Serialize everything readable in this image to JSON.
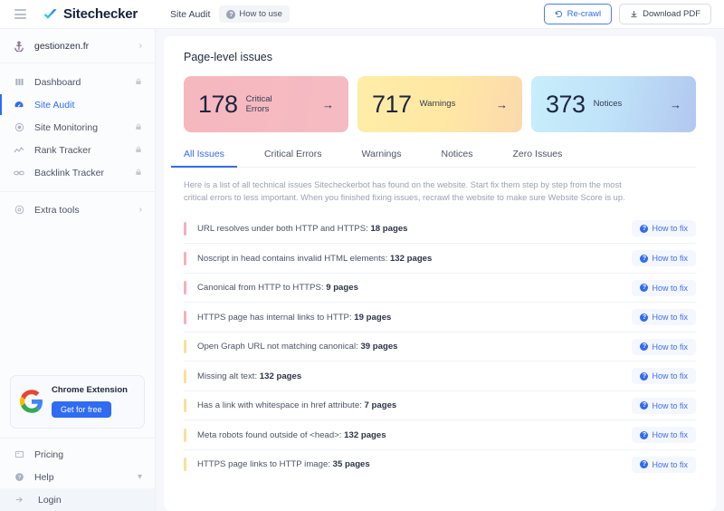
{
  "topbar": {
    "hamburger_icon": "hamburger-icon",
    "brand": "Sitechecker",
    "nav_link": "Site Audit",
    "how_to_use": "How to use",
    "recrawl": "Re-crawl",
    "download_pdf": "Download PDF"
  },
  "sidebar": {
    "site": {
      "name": "gestionzen.fr",
      "icon": "anchor-icon",
      "chevron": "›"
    },
    "items": [
      {
        "label": "Dashboard",
        "icon": "dashboard-icon",
        "locked": true,
        "active": false
      },
      {
        "label": "Site Audit",
        "icon": "site-audit-icon",
        "locked": false,
        "active": true
      },
      {
        "label": "Site Monitoring",
        "icon": "site-monitoring-icon",
        "locked": true,
        "active": false
      },
      {
        "label": "Rank Tracker",
        "icon": "rank-tracker-icon",
        "locked": true,
        "active": false
      },
      {
        "label": "Backlink Tracker",
        "icon": "backlink-tracker-icon",
        "locked": true,
        "active": false
      }
    ],
    "extra_tools": {
      "label": "Extra tools",
      "icon": "extra-tools-icon",
      "chevron": "›"
    },
    "promo": {
      "title": "Chrome Extension",
      "button": "Get for free",
      "logo": "google-logo-icon"
    },
    "footer": [
      {
        "label": "Pricing",
        "icon": "pricing-icon",
        "caret": ""
      },
      {
        "label": "Help",
        "icon": "help-icon",
        "caret": "▾"
      },
      {
        "label": "Login",
        "icon": "login-icon",
        "caret": ""
      }
    ]
  },
  "main": {
    "panel_title": "Page-level issues",
    "cards": [
      {
        "number": "178",
        "label": "Critical Errors",
        "type": "red",
        "arrow": "→"
      },
      {
        "number": "717",
        "label": "Warnings",
        "type": "yellow",
        "arrow": "→"
      },
      {
        "number": "373",
        "label": "Notices",
        "type": "blue",
        "arrow": "→"
      }
    ],
    "tabs": [
      {
        "label": "All Issues",
        "active": true
      },
      {
        "label": "Critical Errors",
        "active": false
      },
      {
        "label": "Warnings",
        "active": false
      },
      {
        "label": "Notices",
        "active": false
      },
      {
        "label": "Zero Issues",
        "active": false
      }
    ],
    "description": "Here is a list of all technical issues Sitecheckerbot has found on the website. Start fix them step by step from the most critical errors to less important. When you finished fixing issues, recrawl the website to make sure Website Score is up.",
    "how_to_fix_label": "How to fix",
    "issues": [
      {
        "title": "URL resolves under both HTTP and HTTPS:",
        "count": "18 pages",
        "severity": "critical"
      },
      {
        "title": "Noscript in head contains invalid HTML elements:",
        "count": "132 pages",
        "severity": "critical"
      },
      {
        "title": "Canonical from HTTP to HTTPS:",
        "count": "9 pages",
        "severity": "critical"
      },
      {
        "title": "HTTPS page has internal links to HTTP:",
        "count": "19 pages",
        "severity": "critical"
      },
      {
        "title": "Open Graph URL not matching canonical:",
        "count": "39 pages",
        "severity": "warning"
      },
      {
        "title": "Missing alt text:",
        "count": "132 pages",
        "severity": "warning"
      },
      {
        "title": "Has a link with whitespace in href attribute:",
        "count": "7 pages",
        "severity": "warning"
      },
      {
        "title": "Meta robots found outside of <head>:",
        "count": "132 pages",
        "severity": "warning"
      },
      {
        "title": "HTTPS page links to HTTP image:",
        "count": "35 pages",
        "severity": "warning"
      }
    ]
  },
  "colors": {
    "accent": "#2f6bf3",
    "critical": "#f7aebb",
    "warning": "#fbdf9a"
  }
}
